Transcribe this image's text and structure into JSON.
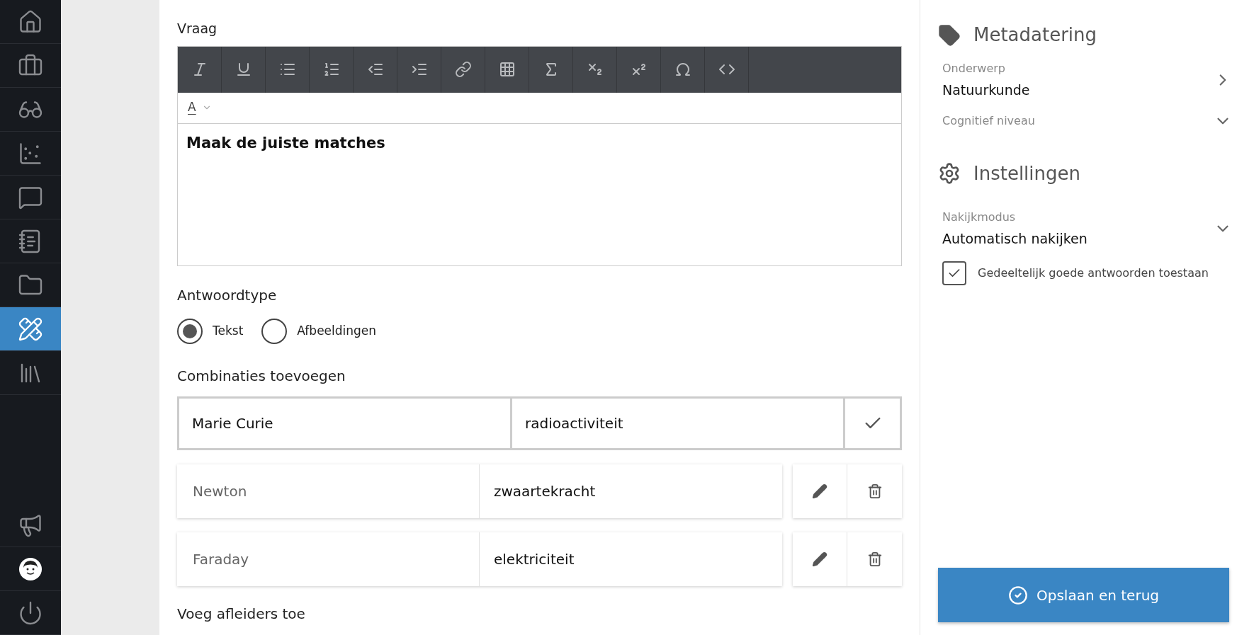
{
  "sidebar": {
    "top_items": [
      {
        "selected": false
      },
      {
        "selected": false
      },
      {
        "selected": false
      },
      {
        "selected": false
      },
      {
        "selected": false
      },
      {
        "selected": false
      },
      {
        "selected": false
      },
      {
        "selected": true
      },
      {
        "selected": false
      }
    ],
    "bottom_items": [
      {
        "selected": false
      },
      {
        "selected": false
      },
      {
        "selected": false
      }
    ]
  },
  "question": {
    "label": "Vraag",
    "font_color_label": "A",
    "content": "Maak de juiste matches"
  },
  "answer_type": {
    "label": "Antwoordtype",
    "options": [
      {
        "label": "Tekst",
        "selected": true
      },
      {
        "label": "Afbeeldingen",
        "selected": false
      }
    ]
  },
  "combinations": {
    "label": "Combinaties toevoegen",
    "new_row": {
      "left": "Marie Curie",
      "right": "radioactiviteit"
    },
    "rows": [
      {
        "left": "Newton",
        "right": "zwaartekracht"
      },
      {
        "left": "Faraday",
        "right": "elektriciteit"
      }
    ]
  },
  "distractors": {
    "label": "Voeg afleiders toe"
  },
  "metadata": {
    "title": "Metadatering",
    "fields": [
      {
        "kind": "link",
        "label": "Onderwerp",
        "value": "Natuurkunde"
      },
      {
        "kind": "dropdown",
        "label": "Cognitief niveau"
      }
    ]
  },
  "settings": {
    "title": "Instellingen",
    "fields": [
      {
        "kind": "dropdown",
        "label": "Nakijkmodus",
        "value": "Automatisch nakijken"
      }
    ],
    "checkbox": {
      "label": "Gedeeltelijk goede antwoorden toestaan",
      "checked": true
    }
  },
  "save_button": {
    "label": "Opslaan en terug"
  }
}
